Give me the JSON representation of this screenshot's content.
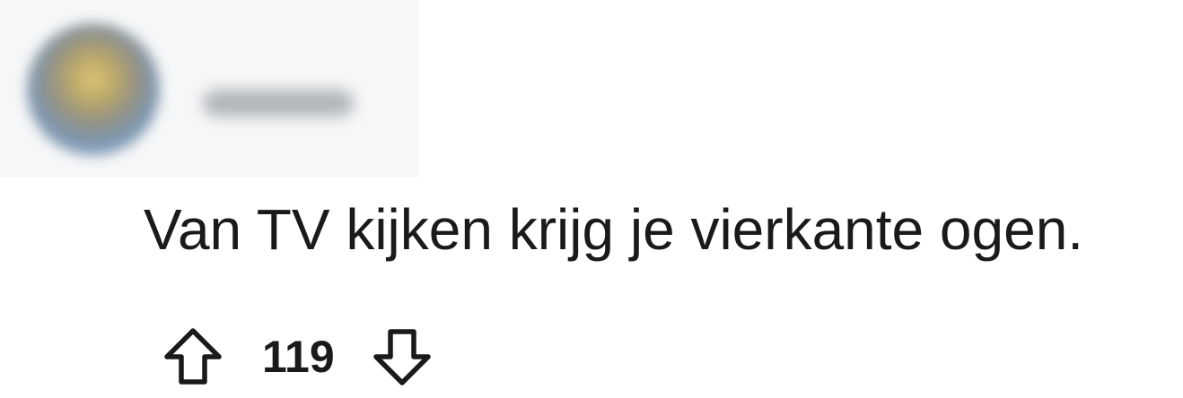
{
  "comment": {
    "author": {
      "avatar_icon": "user-avatar-blurred",
      "username": "",
      "redacted": true
    },
    "body": "Van TV kijken krijg je vierkante ogen.",
    "votes": {
      "score": "119",
      "upvote_icon": "arrow-up-outline-icon",
      "downvote_icon": "arrow-down-outline-icon"
    }
  },
  "colors": {
    "text": "#1a1a1b",
    "background": "#ffffff",
    "header_background": "#f6f7f8"
  }
}
